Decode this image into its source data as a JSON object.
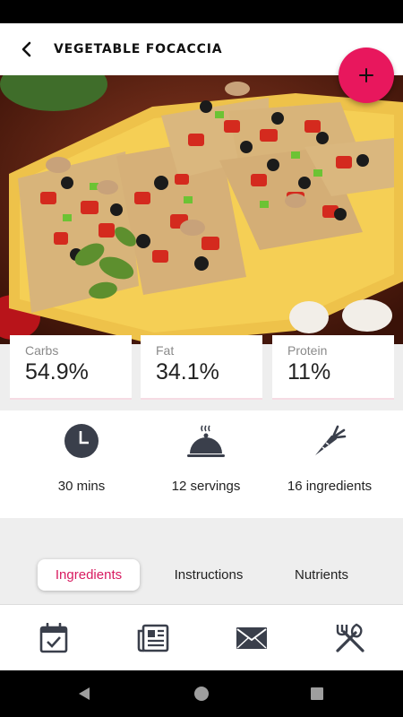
{
  "header": {
    "title": "VEGETABLE FOCACCIA"
  },
  "macros": [
    {
      "label": "Carbs",
      "value": "54.9%"
    },
    {
      "label": "Fat",
      "value": "34.1%"
    },
    {
      "label": "Protein",
      "value": "11%"
    }
  ],
  "stats": [
    {
      "text": "30 mins",
      "icon": "clock-icon"
    },
    {
      "text": "12 servings",
      "icon": "serving-dish-icon"
    },
    {
      "text": "16 ingredients",
      "icon": "carrot-icon"
    }
  ],
  "tabs": [
    {
      "label": "Ingredients",
      "active": true
    },
    {
      "label": "Instructions",
      "active": false
    },
    {
      "label": "Nutrients",
      "active": false
    }
  ],
  "bottom_nav": [
    "calendar-check-icon",
    "newspaper-icon",
    "mail-icon",
    "utensils-icon"
  ],
  "colors": {
    "accent": "#e8175d",
    "active_tab_text": "#d81b60"
  }
}
